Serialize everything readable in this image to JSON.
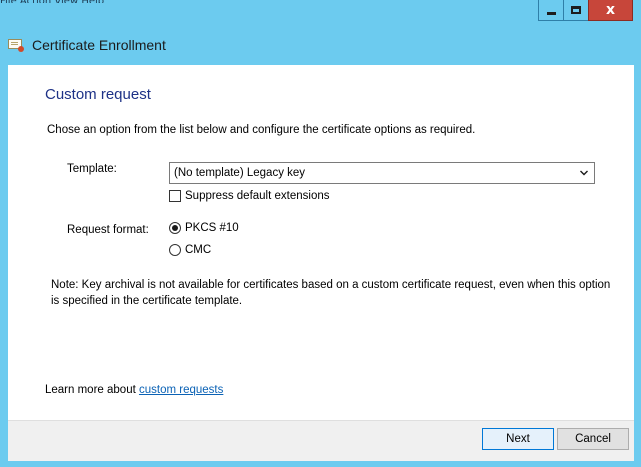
{
  "window": {
    "menu_remnant": "File   Action   View   Help",
    "title": "Certificate Enrollment",
    "close_glyph": "x"
  },
  "page": {
    "heading": "Custom request",
    "instructions": "Chose an option from the list below and configure the certificate options as required.",
    "template_label": "Template:",
    "template_value": "(No template) Legacy key",
    "suppress_label": "Suppress default extensions",
    "suppress_checked": false,
    "format_label": "Request format:",
    "format_options": [
      {
        "label": "PKCS #10",
        "selected": true
      },
      {
        "label": "CMC",
        "selected": false
      }
    ],
    "note": "Note: Key archival is not available for certificates based on a custom certificate request, even when this option is specified in the certificate template.",
    "learn_more_prefix": "Learn more about ",
    "learn_more_link": "custom requests"
  },
  "buttons": {
    "next": "Next",
    "cancel": "Cancel"
  },
  "colors": {
    "frame": "#6ccbef",
    "heading": "#1e3287",
    "link": "#0b62b5",
    "close": "#c7463a"
  }
}
